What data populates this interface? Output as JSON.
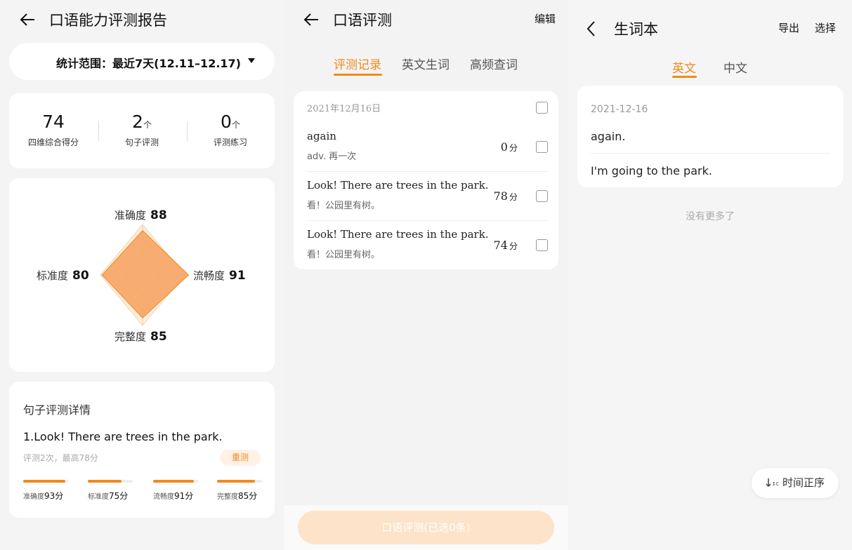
{
  "report": {
    "title": "口语能力评测报告",
    "range_label": "统计范围：最近7天(12.11–12.17)",
    "stats": [
      {
        "value": "74",
        "unit": "",
        "label": "四维综合得分"
      },
      {
        "value": "2",
        "unit": "个",
        "label": "句子评测"
      },
      {
        "value": "0",
        "unit": "个",
        "label": "评测练习"
      }
    ],
    "radar": {
      "accuracy": {
        "label": "准确度",
        "value": "88"
      },
      "fluency": {
        "label": "流畅度",
        "value": "91"
      },
      "completeness": {
        "label": "完整度",
        "value": "85"
      },
      "standard": {
        "label": "标准度",
        "value": "80"
      }
    },
    "detail": {
      "title": "句子评测详情",
      "sentence": "1.Look! There are trees in the park.",
      "meta": "评测2次，最高78分",
      "retest_label": "重测",
      "metrics": [
        {
          "label": "准确度",
          "score": "93分",
          "fill": 0.93
        },
        {
          "label": "标准度",
          "score": "75分",
          "fill": 0.75
        },
        {
          "label": "流畅度",
          "score": "91分",
          "fill": 0.91
        },
        {
          "label": "完整度",
          "score": "85分",
          "fill": 0.85
        }
      ]
    }
  },
  "records": {
    "title": "口语评测",
    "edit_label": "编辑",
    "tabs": [
      {
        "label": "评测记录",
        "active": true
      },
      {
        "label": "英文生词",
        "active": false
      },
      {
        "label": "高频查词",
        "active": false
      }
    ],
    "date": "2021年12月16日",
    "items": [
      {
        "en": "again",
        "cn": "adv. 再一次",
        "score": "0",
        "unit": "分"
      },
      {
        "en": "Look! There are trees in the park.",
        "cn": "看！公园里有树。",
        "score": "78",
        "unit": "分"
      },
      {
        "en": "Look! There are trees in the park.",
        "cn": "看！公园里有树。",
        "score": "74",
        "unit": "分"
      }
    ],
    "bottom_button": "口语评测(已选0条)"
  },
  "vocab": {
    "title": "生词本",
    "export_label": "导出",
    "select_label": "选择",
    "tabs": [
      {
        "label": "英文",
        "active": true
      },
      {
        "label": "中文",
        "active": false
      }
    ],
    "date": "2021-12-16",
    "words": [
      "again.",
      "I'm going to the park."
    ],
    "no_more": "没有更多了",
    "sort_label": "时间正序"
  },
  "colors": {
    "accent": "#f08a1c",
    "radar_fill": "#f6a565",
    "radar_bg": "#fde6d2"
  }
}
